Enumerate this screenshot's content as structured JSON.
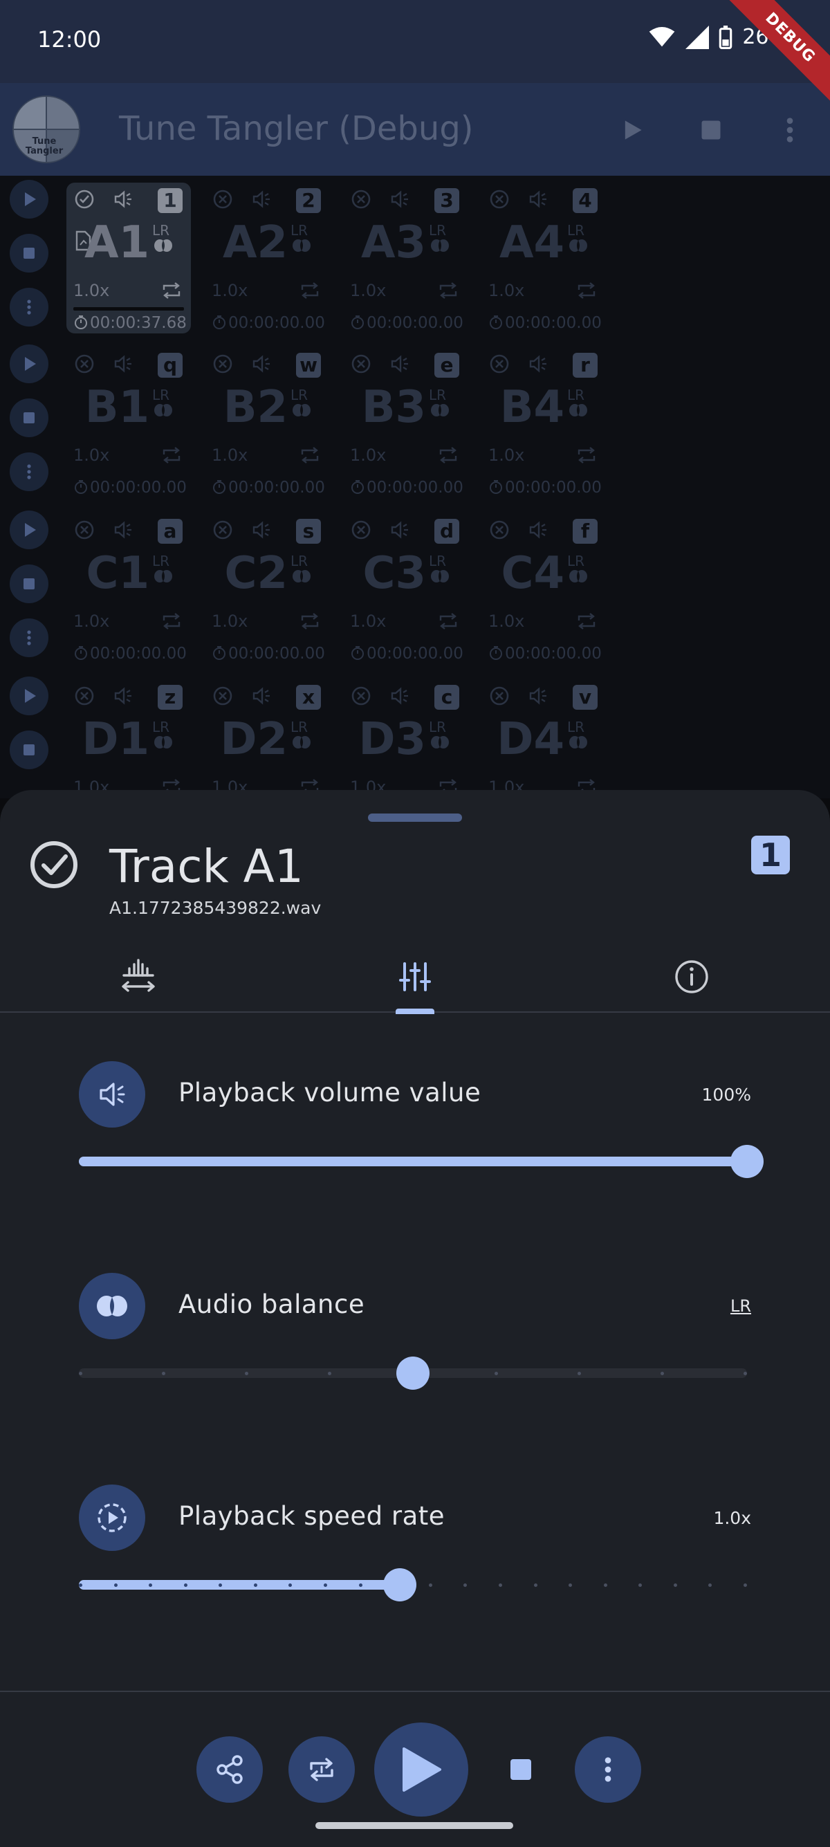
{
  "status_bar": {
    "time": "12:00",
    "battery": "26%",
    "wifi_icon": "wifi-icon",
    "signal_icon": "signal-icon",
    "battery_icon": "battery-icon"
  },
  "debug_banner": "DEBUG",
  "app_bar": {
    "title": "Tune Tangler (Debug)",
    "logo_text": "Tune Tangler",
    "actions": [
      "play-icon",
      "stop-icon",
      "more-vert-icon"
    ]
  },
  "grid": {
    "rows": [
      {
        "cells": [
          {
            "name": "A1",
            "key": "1",
            "rate": "1.0x",
            "duration": "00:00:37.68",
            "lr": "LR",
            "selected": true
          },
          {
            "name": "A2",
            "key": "2",
            "rate": "1.0x",
            "duration": "00:00:00.00",
            "lr": "LR",
            "selected": false
          },
          {
            "name": "A3",
            "key": "3",
            "rate": "1.0x",
            "duration": "00:00:00.00",
            "lr": "LR",
            "selected": false
          },
          {
            "name": "A4",
            "key": "4",
            "rate": "1.0x",
            "duration": "00:00:00.00",
            "lr": "LR",
            "selected": false
          }
        ]
      },
      {
        "cells": [
          {
            "name": "B1",
            "key": "q",
            "rate": "1.0x",
            "duration": "00:00:00.00",
            "lr": "LR",
            "selected": false
          },
          {
            "name": "B2",
            "key": "w",
            "rate": "1.0x",
            "duration": "00:00:00.00",
            "lr": "LR",
            "selected": false
          },
          {
            "name": "B3",
            "key": "e",
            "rate": "1.0x",
            "duration": "00:00:00.00",
            "lr": "LR",
            "selected": false
          },
          {
            "name": "B4",
            "key": "r",
            "rate": "1.0x",
            "duration": "00:00:00.00",
            "lr": "LR",
            "selected": false
          }
        ]
      },
      {
        "cells": [
          {
            "name": "C1",
            "key": "a",
            "rate": "1.0x",
            "duration": "00:00:00.00",
            "lr": "LR",
            "selected": false
          },
          {
            "name": "C2",
            "key": "s",
            "rate": "1.0x",
            "duration": "00:00:00.00",
            "lr": "LR",
            "selected": false
          },
          {
            "name": "C3",
            "key": "d",
            "rate": "1.0x",
            "duration": "00:00:00.00",
            "lr": "LR",
            "selected": false
          },
          {
            "name": "C4",
            "key": "f",
            "rate": "1.0x",
            "duration": "00:00:00.00",
            "lr": "LR",
            "selected": false
          }
        ]
      },
      {
        "cells": [
          {
            "name": "D1",
            "key": "z",
            "rate": "1.0x",
            "duration": "",
            "lr": "LR",
            "selected": false
          },
          {
            "name": "D2",
            "key": "x",
            "rate": "1.0x",
            "duration": "",
            "lr": "LR",
            "selected": false
          },
          {
            "name": "D3",
            "key": "c",
            "rate": "1.0x",
            "duration": "",
            "lr": "LR",
            "selected": false
          },
          {
            "name": "D4",
            "key": "v",
            "rate": "1.0x",
            "duration": "",
            "lr": "LR",
            "selected": false
          }
        ]
      }
    ],
    "selected_progress": 0.98
  },
  "sheet": {
    "title": "Track A1",
    "filename": "A1.1772385439822.wav",
    "badge": "1",
    "tabs": [
      {
        "name": "waveform-trim-icon",
        "active": false
      },
      {
        "name": "tune-sliders-icon",
        "active": true
      },
      {
        "name": "info-icon",
        "active": false
      }
    ],
    "settings": {
      "volume": {
        "label": "Playback volume value",
        "value": "100%",
        "level": 1.0
      },
      "balance": {
        "label": "Audio balance",
        "value": "LR",
        "level": 0.5,
        "steps": 8
      },
      "speed": {
        "label": "Playback speed rate",
        "value": "1.0x",
        "level": 0.48,
        "steps": 19
      }
    }
  },
  "bottom_bar": {
    "actions": [
      "share-icon",
      "repeat-icon",
      "play-icon",
      "stop-icon",
      "more-vert-icon"
    ]
  },
  "colors": {
    "accent": "#a9c2f6",
    "accent_container": "#2f4473",
    "app_bar": "#243150",
    "sheet": "#1d2026"
  }
}
